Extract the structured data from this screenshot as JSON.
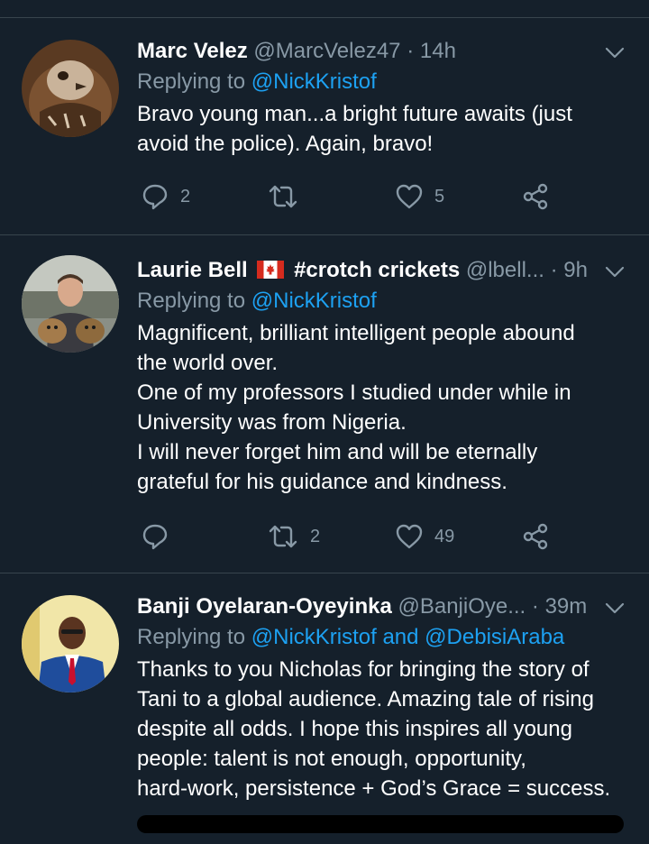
{
  "tweets": [
    {
      "name": "Marc Velez",
      "handle": "@MarcVelez47",
      "separator": "·",
      "time": "14h",
      "replying_prefix": "Replying to",
      "replying_to": "@NickKristof",
      "lines": [
        "Bravo young man...a bright future awaits (just",
        "avoid the police). Again, bravo!"
      ],
      "reply_count": "2",
      "retweet_count": "",
      "like_count": "5"
    },
    {
      "name": "Laurie Bell",
      "name_suffix": "#crotch crickets",
      "flag": "canada-flag",
      "handle": "@lbell...",
      "separator": "·",
      "time": "9h",
      "replying_prefix": "Replying to",
      "replying_to": "@NickKristof",
      "lines": [
        "Magnificent, brilliant intelligent people abound",
        "the world over.",
        "One of my professors I studied under while in",
        "University was from Nigeria.",
        "I will never forget him and will be eternally",
        "grateful for his guidance and kindness."
      ],
      "reply_count": "",
      "retweet_count": "2",
      "like_count": "49"
    },
    {
      "name": "Banji Oyelaran-Oyeyinka",
      "handle": "@BanjiOye...",
      "separator": "·",
      "time": "39m",
      "replying_prefix": "Replying to",
      "replying_to": "@NickKristof and @DebisiAraba",
      "lines": [
        "Thanks to you Nicholas for bringing the story of",
        "Tani to a global audience. Amazing tale of rising",
        "despite all odds. I hope this inspires all young",
        "people: talent is not enough, opportunity,",
        "hard-work, persistence + God’s Grace = success."
      ]
    }
  ],
  "icons": {
    "reply": "reply-icon",
    "retweet": "retweet-icon",
    "like": "heart-icon",
    "share": "share-icon",
    "more": "chevron-down-icon"
  },
  "colors": {
    "background": "#15202b",
    "divider": "#38444d",
    "secondary_text": "#8899a6",
    "link": "#1da1f2"
  }
}
